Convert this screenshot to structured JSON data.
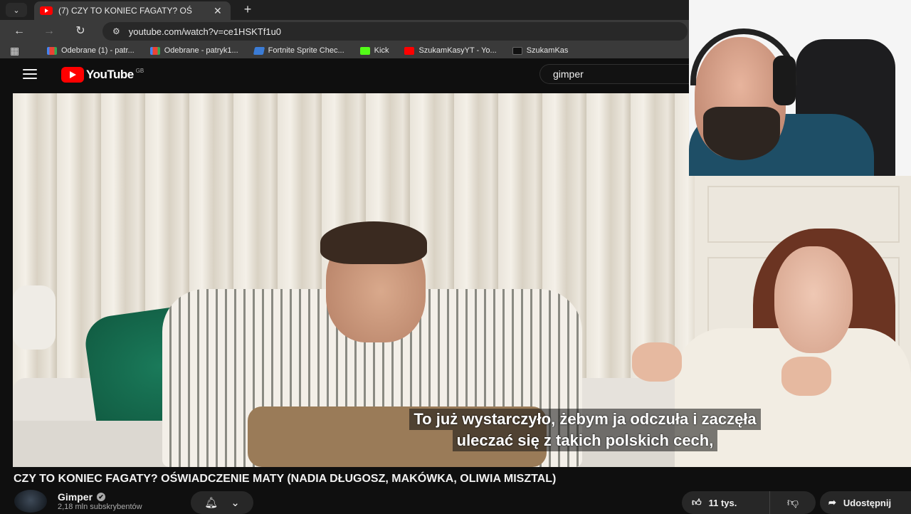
{
  "browser": {
    "tab": {
      "title": "(7) CZY TO KONIEC FAGATY? OŚ",
      "favicon": "youtube-icon"
    },
    "new_tab_label": "+",
    "url": "youtube.com/watch?v=ce1HSKTf1u0",
    "bookmarks": [
      {
        "label": "Odebrane (1) - patr...",
        "icon": "gmail-icon"
      },
      {
        "label": "Odebrane - patryk1...",
        "icon": "gmail-icon"
      },
      {
        "label": "Fortnite Sprite Chec...",
        "icon": "fortnite-icon"
      },
      {
        "label": "Kick",
        "icon": "kick-icon"
      },
      {
        "label": "SzukamKasyYT - Yo...",
        "icon": "youtube-icon"
      },
      {
        "label": "SzukamKas",
        "icon": "tiktok-icon"
      }
    ]
  },
  "youtube": {
    "logo_text": "YouTube",
    "region": "GB",
    "search_value": "gimper"
  },
  "video": {
    "subtitle_line1": "To już wystarczyło, żebym ja odczuła i zaczęła",
    "subtitle_line2": "uleczać się z takich polskich cech,",
    "title": "CZY TO KONIEC FAGATY? OŚWIADCZENIE MATY (NADIA DŁUGOSZ, MAKÓWKA, OLIWIA MISZTAL)"
  },
  "channel": {
    "name": "Gimper",
    "subscribers": "2,18 mln subskrybentów",
    "verified_icon": "✔"
  },
  "actions": {
    "like_count": "11 tys.",
    "share_label": "Udostępnij"
  },
  "colors": {
    "youtube_red": "#ff0000",
    "background": "#0f0f0f"
  }
}
